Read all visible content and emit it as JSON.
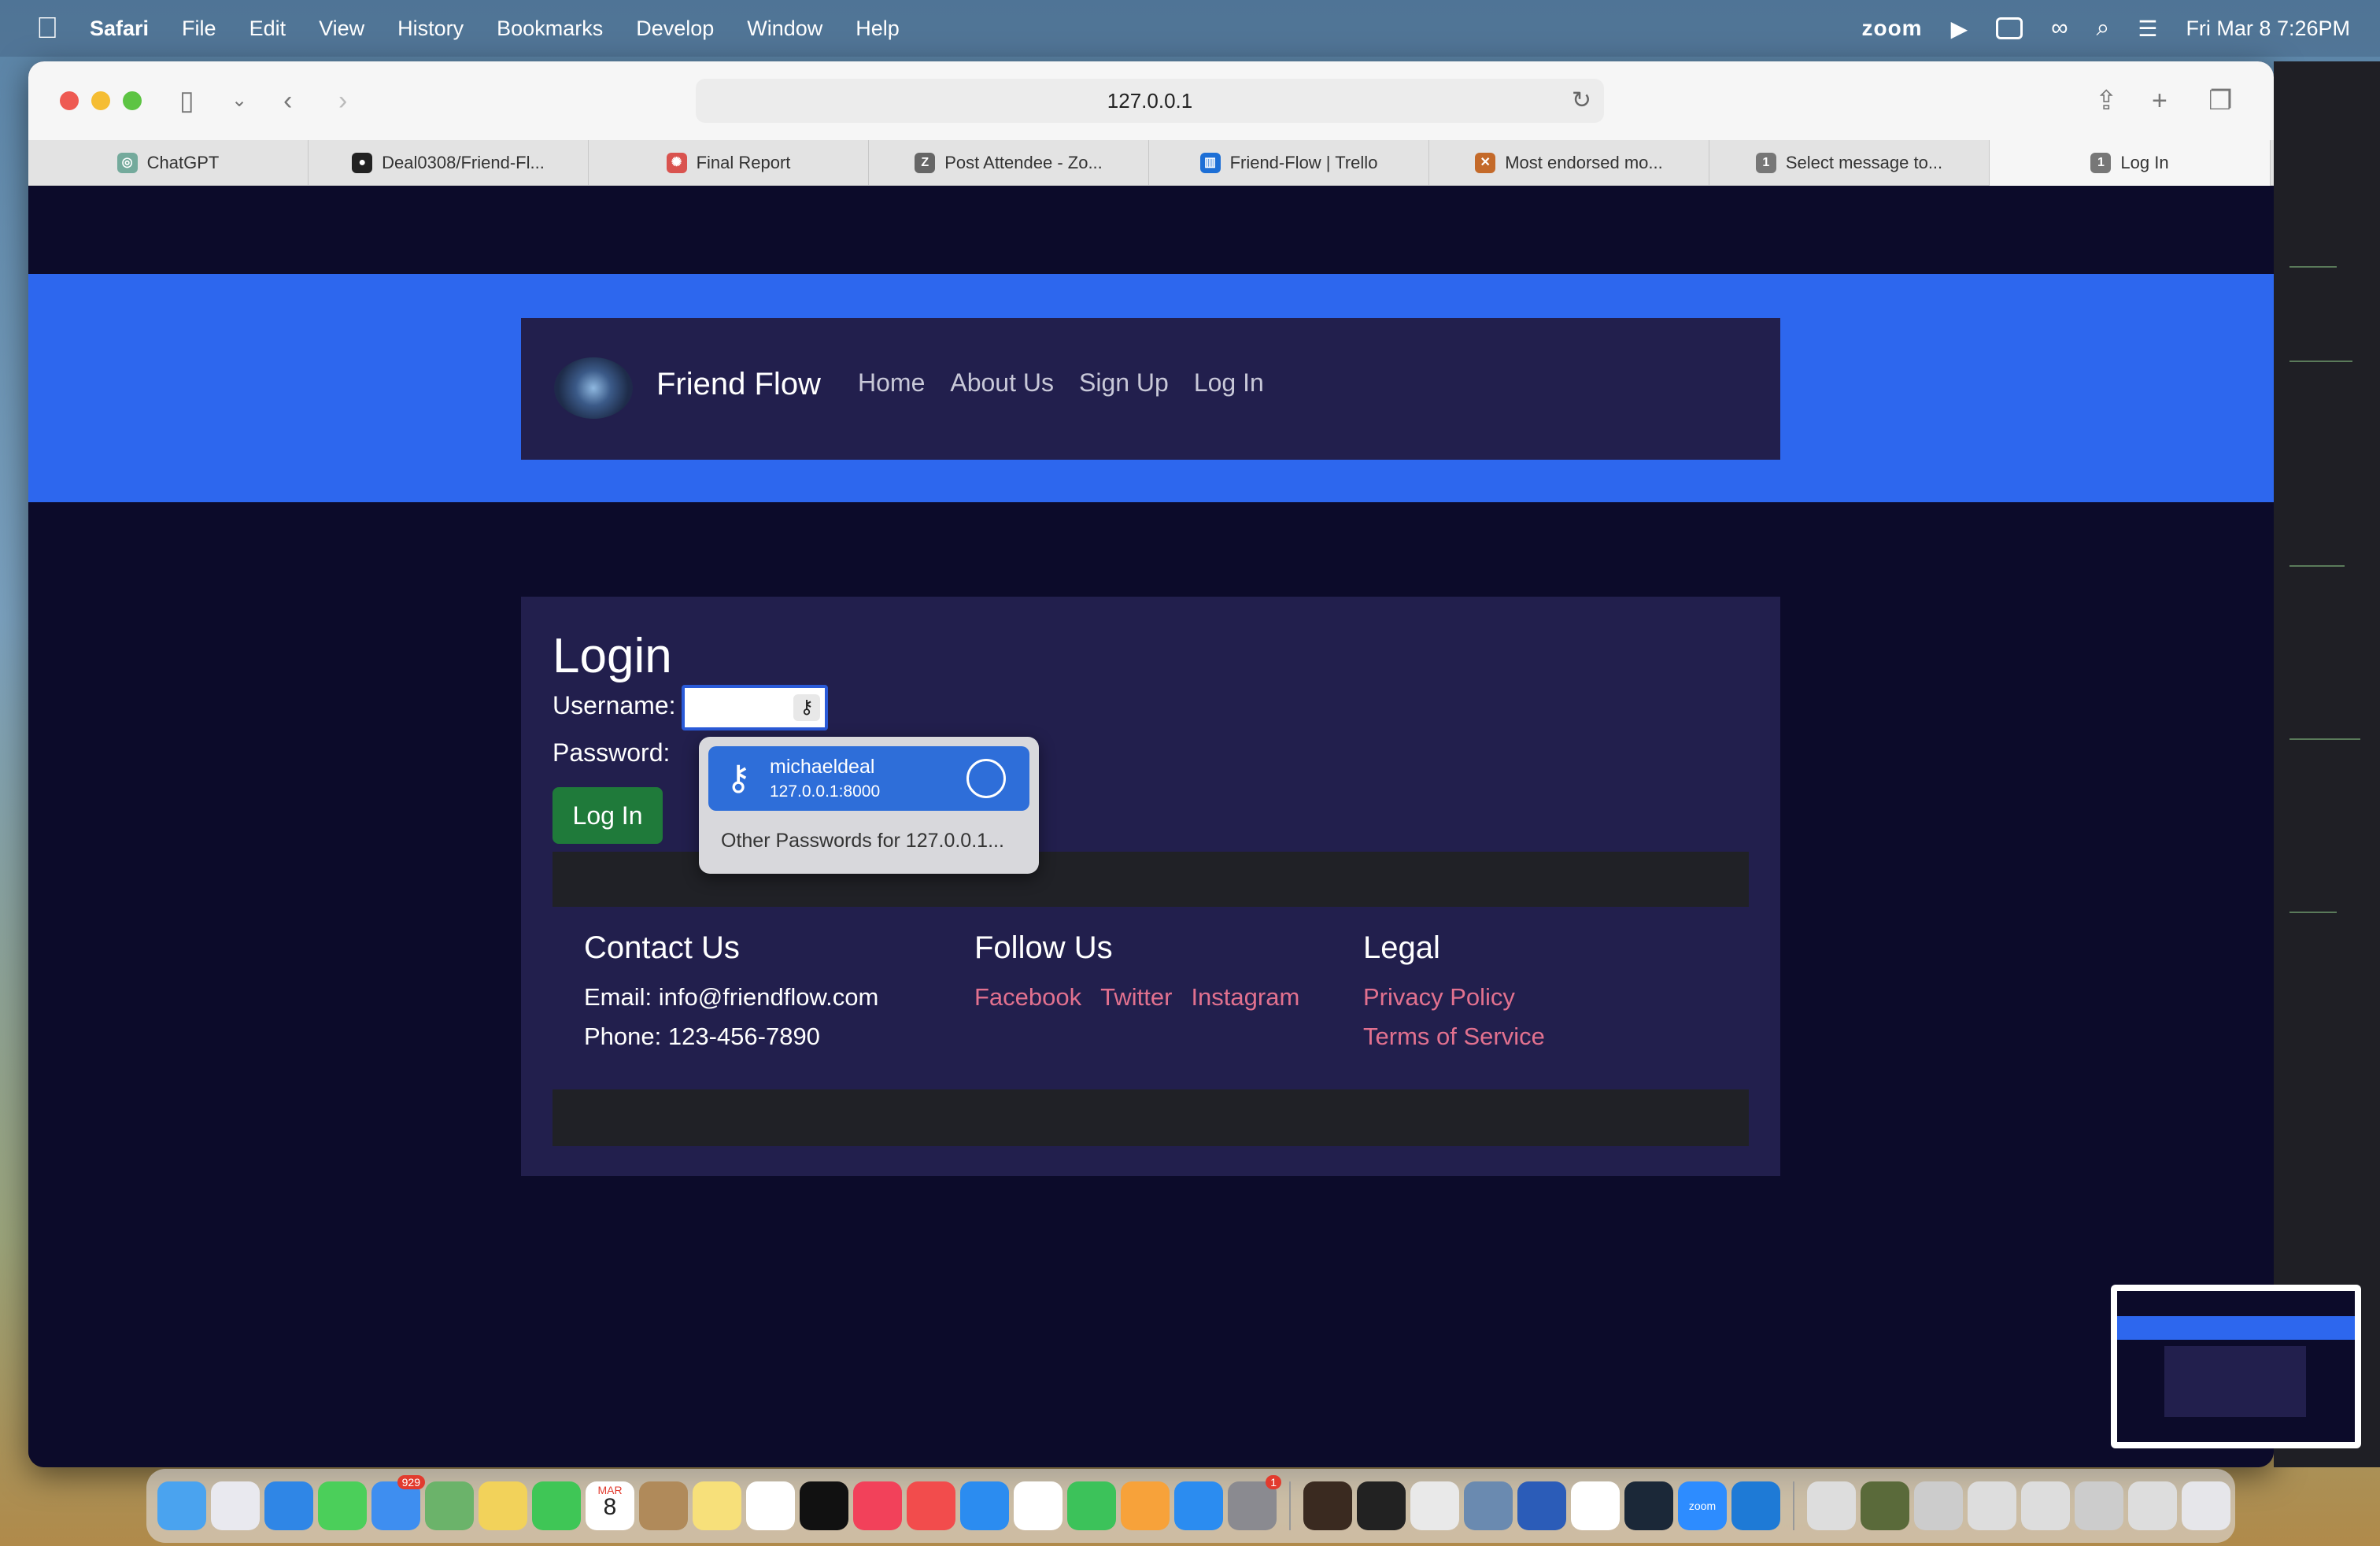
{
  "menubar": {
    "app": "Safari",
    "items": [
      "File",
      "Edit",
      "View",
      "History",
      "Bookmarks",
      "Develop",
      "Window",
      "Help"
    ],
    "zoom": "zoom",
    "datetime": "Fri Mar 8  7:26PM"
  },
  "browser": {
    "url": "127.0.0.1",
    "tabs": [
      {
        "label": "ChatGPT",
        "icon": "chatgpt-icon",
        "color": "#74aa9c",
        "glyph": "◎"
      },
      {
        "label": "Deal0308/Friend-Fl...",
        "icon": "github-icon",
        "color": "#222222",
        "glyph": "●"
      },
      {
        "label": "Final Report",
        "icon": "settings-icon",
        "color": "#d9534f",
        "glyph": "✺"
      },
      {
        "label": "Post Attendee - Zo...",
        "icon": "zoom-icon",
        "color": "#666666",
        "glyph": "Z"
      },
      {
        "label": "Friend-Flow | Trello",
        "icon": "trello-icon",
        "color": "#1d6fd6",
        "glyph": "▥"
      },
      {
        "label": "Most endorsed mo...",
        "icon": "page-icon",
        "color": "#c46a2a",
        "glyph": "✕"
      },
      {
        "label": "Select message to...",
        "icon": "number-icon",
        "color": "#777777",
        "glyph": "1"
      },
      {
        "label": "Log In",
        "icon": "number-icon",
        "color": "#777777",
        "glyph": "1"
      }
    ]
  },
  "site": {
    "brand": "Friend Flow",
    "nav": [
      "Home",
      "About Us",
      "Sign Up",
      "Log In"
    ],
    "login": {
      "title": "Login",
      "username_label": "Username:",
      "password_label": "Password:",
      "button": "Log In"
    },
    "autofill": {
      "user": "michaeldeal",
      "site": "127.0.0.1:8000",
      "other": "Other Passwords for 127.0.0.1..."
    },
    "footer": {
      "contact_title": "Contact Us",
      "email": "Email: info@friendflow.com",
      "phone": "Phone: 123-456-7890",
      "follow_title": "Follow Us",
      "social": [
        "Facebook",
        "Twitter",
        "Instagram"
      ],
      "legal_title": "Legal",
      "legal": [
        "Privacy Policy",
        "Terms of Service"
      ]
    }
  },
  "dock": {
    "mail_badge": "929",
    "calendar_month": "MAR",
    "calendar_day": "8",
    "settings_badge": "1",
    "zoom_label": "zoom"
  },
  "colors": {
    "page_bg": "#0c0b2a",
    "hero": "#2d67ee",
    "card": "#221f4d",
    "button": "#1f7a3a",
    "link": "#e2718f"
  }
}
